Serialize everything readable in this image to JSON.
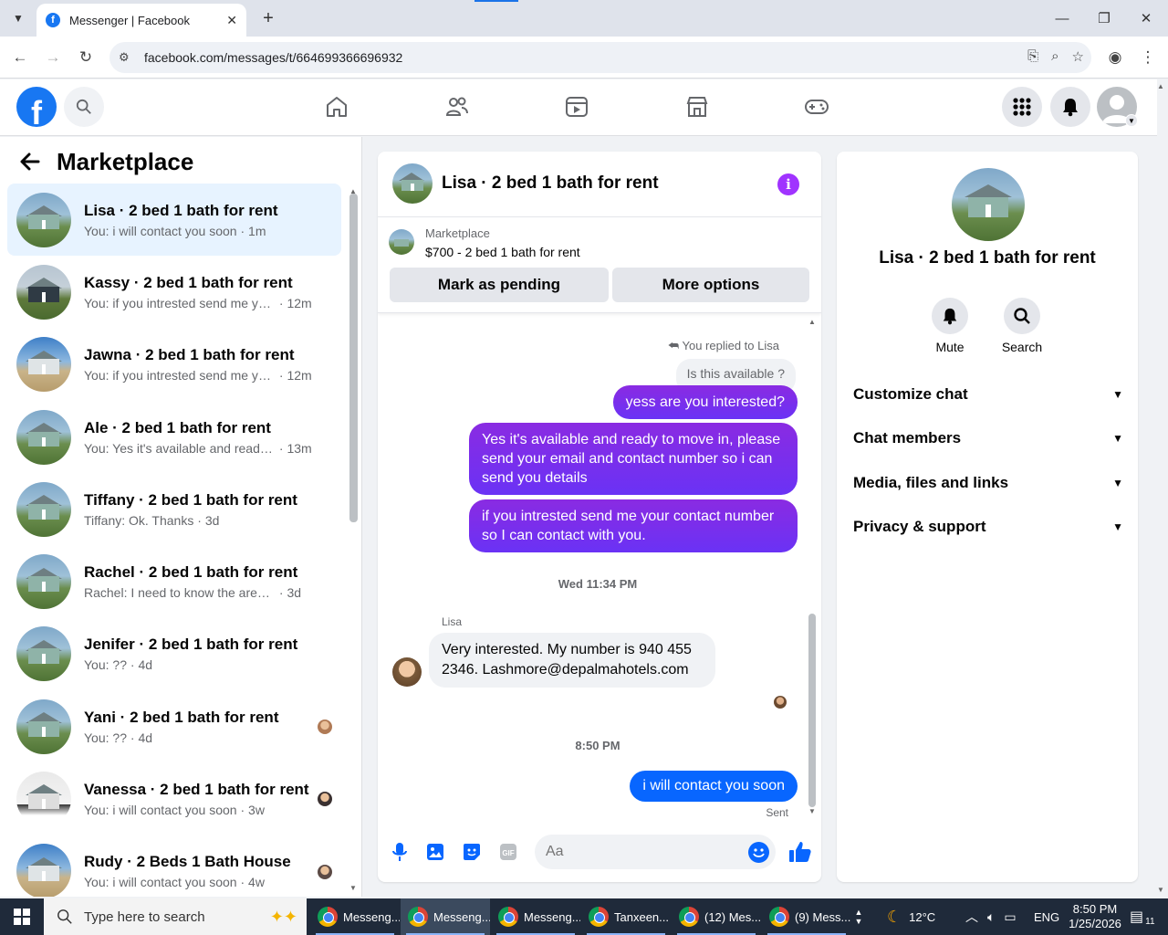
{
  "browser": {
    "tab_title": "Messenger | Facebook",
    "url": "facebook.com/messages/t/664699366696932"
  },
  "left": {
    "title": "Marketplace",
    "conversations": [
      {
        "name": "Lisa · 2 bed 1 bath for rent",
        "preview": "You: i will contact you soon",
        "time": "1m",
        "thumb": "house-green"
      },
      {
        "name": "Kassy · 2 bed 1 bath for rent",
        "preview": "You: if you intrested send me you...",
        "time": "12m",
        "thumb": "house-dark"
      },
      {
        "name": "Jawna · 2 bed 1 bath for rent",
        "preview": "You: if you intrested send me you...",
        "time": "12m",
        "thumb": "house-sky"
      },
      {
        "name": "Ale · 2 bed 1 bath for rent",
        "preview": "You: Yes it's available and ready t...",
        "time": "13m",
        "thumb": "house-green"
      },
      {
        "name": "Tiffany · 2 bed 1 bath for rent",
        "preview": "Tiffany: Ok. Thanks",
        "time": "3d",
        "thumb": "house-green"
      },
      {
        "name": "Rachel · 2 bed 1 bath for rent",
        "preview": "Rachel: I need to know the area bef...",
        "time": "3d",
        "thumb": "house-green"
      },
      {
        "name": "Jenifer · 2 bed 1 bath for rent",
        "preview": "You: ??",
        "time": "4d",
        "thumb": "house-green"
      },
      {
        "name": "Yani · 2 bed 1 bath for rent",
        "preview": "You: ??",
        "time": "4d",
        "thumb": "house-green"
      },
      {
        "name": "Vanessa · 2 bed 1 bath for rent",
        "preview": "You: i will contact you soon",
        "time": "3w",
        "thumb": "house-white"
      },
      {
        "name": "Rudy · 2 Beds 1 Bath House",
        "preview": "You: i will contact you soon",
        "time": "4w",
        "thumb": "house-sky"
      }
    ]
  },
  "chat": {
    "title": "Lisa · 2 bed 1 bath for rent",
    "listing_label": "Marketplace",
    "listing_price": "$700 - 2 bed 1 bath for rent",
    "mark_pending": "Mark as pending",
    "more_options": "More options",
    "replied_to": "You replied to Lisa",
    "quoted": "Is this available ?",
    "out1": "yess are you interested?",
    "out2": "Yes it's available and ready to move in, please send your email and contact number so i can send you details",
    "out3": "if you intrested send me your contact number so I can contact with you.",
    "ts1": "Wed 11:34 PM",
    "sender": "Lisa",
    "in1": "Very interested. My number is 940 455 2346.  Lashmore@depalmahotels.com",
    "ts2": "8:50 PM",
    "out4": "i will contact you soon",
    "sent": "Sent",
    "composer_placeholder": "Aa"
  },
  "info": {
    "title": "Lisa · 2 bed 1 bath for rent",
    "mute": "Mute",
    "search": "Search",
    "sections": [
      "Customize chat",
      "Chat members",
      "Media, files and links",
      "Privacy & support"
    ]
  },
  "taskbar": {
    "search_placeholder": "Type here to search",
    "apps": [
      "Messeng...",
      "Messeng...",
      "Messeng...",
      "Tanxeen...",
      "(12) Mes...",
      "(9) Mess..."
    ],
    "weather": "12°C",
    "lang": "ENG",
    "time": "8:50 PM",
    "date": "1/25/2026",
    "notifications": "11"
  },
  "colors": {
    "fb_blue": "#1877f2",
    "bubble_purple": "#7b2ff7",
    "bubble_blue": "#0866ff",
    "active_row": "#e7f3ff"
  }
}
